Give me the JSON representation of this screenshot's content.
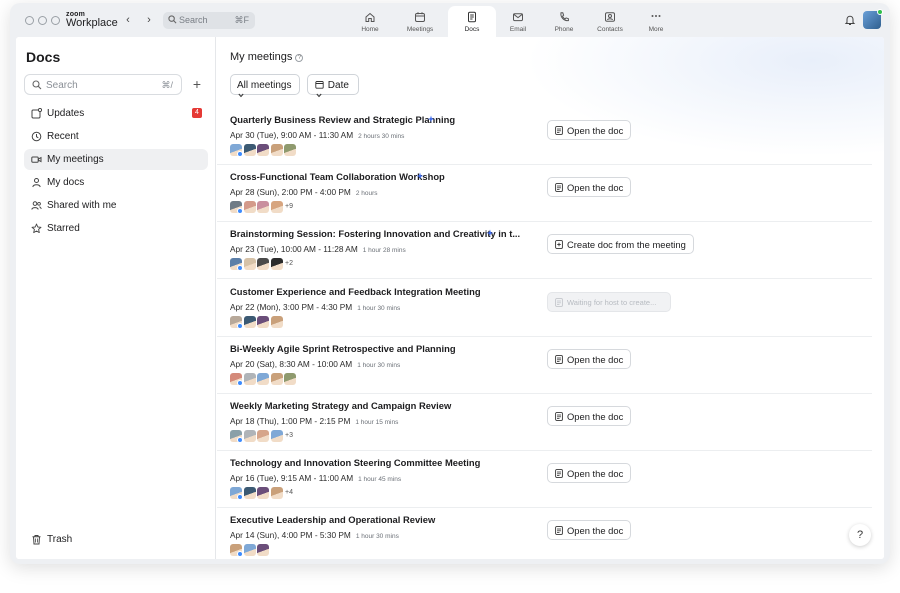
{
  "app": {
    "brand_small": "zoom",
    "brand_name": "Workplace"
  },
  "search": {
    "placeholder": "Search",
    "shortcut": "⌘F"
  },
  "nav": [
    {
      "label": "Home",
      "icon": "home-icon"
    },
    {
      "label": "Meetings",
      "icon": "calendar-icon"
    },
    {
      "label": "Docs",
      "icon": "doc-icon",
      "active": true
    },
    {
      "label": "Email",
      "icon": "mail-icon"
    },
    {
      "label": "Phone",
      "icon": "phone-icon"
    },
    {
      "label": "Contacts",
      "icon": "contacts-icon"
    },
    {
      "label": "More",
      "icon": "more-icon"
    }
  ],
  "sidebar": {
    "title": "Docs",
    "search_placeholder": "Search",
    "search_shortcut": "⌘/",
    "add": "+",
    "items": [
      {
        "label": "Updates",
        "icon": "updates-icon",
        "badge": "4"
      },
      {
        "label": "Recent",
        "icon": "clock-icon"
      },
      {
        "label": "My meetings",
        "icon": "video-icon",
        "active": true
      },
      {
        "label": "My docs",
        "icon": "person-icon"
      },
      {
        "label": "Shared with me",
        "icon": "people-icon"
      },
      {
        "label": "Starred",
        "icon": "star-icon"
      }
    ],
    "trash": "Trash"
  },
  "main": {
    "title": "My meetings",
    "help_mark": "?",
    "filters": {
      "meetings": "All meetings",
      "date": "Date"
    },
    "help_button": "?",
    "meetings": [
      {
        "title": "Quarterly Business Review and Strategic Planning",
        "ai": true,
        "date": "Apr 30 (Tue), 9:00 AM - 11:30 AM",
        "duration": "2 hours 30 mins",
        "avatars": [
          "#7fa8d6",
          "#3c5a73",
          "#6b4e7a",
          "#c9a07a",
          "#8f9a6e"
        ],
        "more": "",
        "action": "Open the doc",
        "action_type": "open"
      },
      {
        "title": "Cross-Functional Team Collaboration Workshop",
        "ai": true,
        "date": "Apr 28 (Sun), 2:00 PM - 4:00 PM",
        "duration": "2 hours",
        "avatars": [
          "#6f7b86",
          "#d49a8a",
          "#c98f9e",
          "#d7a57f"
        ],
        "more": "+9",
        "action": "Open the doc",
        "action_type": "open"
      },
      {
        "title": "Brainstorming Session: Fostering Innovation and Creativity in t...",
        "ai": true,
        "date": "Apr 23 (Tue), 10:00 AM - 11:28 AM",
        "duration": "1 hour 28 mins",
        "avatars": [
          "#5c7fa8",
          "#d6c2a8",
          "#4a4a4a",
          "#2b2b2b"
        ],
        "more": "+2",
        "action": "Create doc from the meeting",
        "action_type": "create"
      },
      {
        "title": "Customer Experience and Feedback Integration Meeting",
        "ai": false,
        "date": "Apr 22 (Mon), 3:00 PM - 4:30 PM",
        "duration": "1 hour 30 mins",
        "avatars": [
          "#b8a99a",
          "#3c5a73",
          "#6b4e7a",
          "#c9a07a"
        ],
        "more": "",
        "action": "Waiting for host to create...",
        "action_type": "waiting"
      },
      {
        "title": "Bi-Weekly Agile Sprint Retrospective and Planning",
        "ai": false,
        "date": "Apr 20 (Sat), 8:30 AM - 10:00 AM",
        "duration": "1 hour 30 mins",
        "avatars": [
          "#d48a7a",
          "#b0b4b8",
          "#7fa8d6",
          "#c9a07a",
          "#8f9a6e"
        ],
        "more": "",
        "action": "Open the doc",
        "action_type": "open"
      },
      {
        "title": "Weekly Marketing Strategy and Campaign Review",
        "ai": false,
        "date": "Apr 18 (Thu), 1:00 PM - 2:15 PM",
        "duration": "1 hour 15 mins",
        "avatars": [
          "#8aa0a8",
          "#b0b4b8",
          "#d6a58a",
          "#7fa8d6"
        ],
        "more": "+3",
        "action": "Open the doc",
        "action_type": "open"
      },
      {
        "title": "Technology and Innovation Steering Committee Meeting",
        "ai": false,
        "date": "Apr 16 (Tue), 9:15 AM - 11:00 AM",
        "duration": "1 hour 45 mins",
        "avatars": [
          "#7fa8d6",
          "#3c5a73",
          "#6b4e7a",
          "#c9a07a"
        ],
        "more": "+4",
        "action": "Open the doc",
        "action_type": "open"
      },
      {
        "title": "Executive Leadership and Operational Review",
        "ai": false,
        "date": "Apr 14 (Sun), 4:00 PM - 5:30 PM",
        "duration": "1 hour 30 mins",
        "avatars": [
          "#c9a07a",
          "#7fa8d6",
          "#6b4e7a"
        ],
        "more": "",
        "action": "Open the doc",
        "action_type": "open"
      }
    ]
  }
}
